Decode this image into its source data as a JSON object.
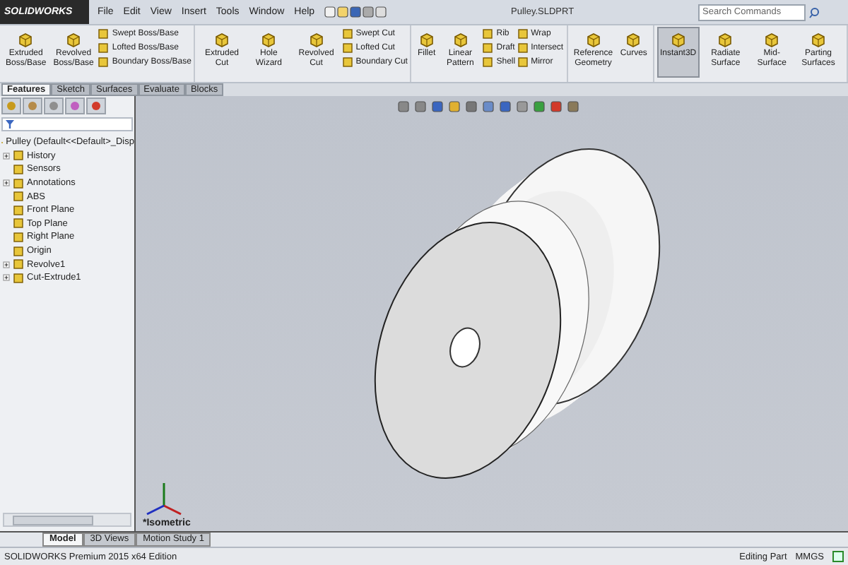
{
  "window": {
    "logo": "SOLIDWORKS",
    "menu": [
      "File",
      "Edit",
      "View",
      "Insert",
      "Tools",
      "Window",
      "Help"
    ],
    "title": "Pulley.SLDPRT",
    "search": {
      "placeholder": "Search Commands"
    }
  },
  "ribbon": [
    {
      "tools": [
        {
          "kind": "large",
          "label": "Extruded Boss/Base",
          "selected": false
        },
        {
          "kind": "large",
          "label": "Revolved Boss/Base",
          "selected": false
        },
        {
          "kind": "stack",
          "items": [
            "Swept Boss/Base",
            "Lofted Boss/Base",
            "Boundary Boss/Base"
          ]
        }
      ]
    },
    {
      "tools": [
        {
          "kind": "large",
          "label": "Extruded Cut",
          "selected": false
        },
        {
          "kind": "large",
          "label": "Hole Wizard",
          "selected": false
        },
        {
          "kind": "large",
          "label": "Revolved Cut",
          "selected": false
        },
        {
          "kind": "stack",
          "items": [
            "Swept Cut",
            "Lofted Cut",
            "Boundary Cut"
          ]
        }
      ]
    },
    {
      "tools": [
        {
          "kind": "large",
          "label": "Fillet",
          "selected": false
        },
        {
          "kind": "large",
          "label": "Linear Pattern",
          "selected": false
        },
        {
          "kind": "stack",
          "items": [
            "Rib",
            "Draft",
            "Shell"
          ]
        },
        {
          "kind": "stack",
          "items": [
            "Wrap",
            "Intersect",
            "Mirror"
          ]
        }
      ]
    },
    {
      "tools": [
        {
          "kind": "large",
          "label": "Reference Geometry",
          "selected": false
        },
        {
          "kind": "large",
          "label": "Curves",
          "selected": false
        }
      ]
    },
    {
      "tools": [
        {
          "kind": "large",
          "label": "Instant3D",
          "selected": true
        },
        {
          "kind": "large",
          "label": "Radiate Surface",
          "selected": false
        },
        {
          "kind": "large",
          "label": "Mid-Surface",
          "selected": false
        },
        {
          "kind": "large",
          "label": "Parting Surfaces",
          "selected": false
        }
      ]
    }
  ],
  "command_tabs": [
    {
      "label": "Features",
      "selected": true
    },
    {
      "label": "Sketch",
      "selected": false
    },
    {
      "label": "Surfaces",
      "selected": false
    },
    {
      "label": "Evaluate",
      "selected": false
    },
    {
      "label": "Blocks",
      "selected": false
    }
  ],
  "tree": {
    "root": "Pulley  (Default<<Default>_Disp",
    "items": [
      {
        "label": "History",
        "expanded": false
      },
      {
        "label": "Sensors"
      },
      {
        "label": "Annotations",
        "expanded": false
      },
      {
        "label": "ABS"
      },
      {
        "label": "Front Plane"
      },
      {
        "label": "Top Plane"
      },
      {
        "label": "Right Plane"
      },
      {
        "label": "Origin"
      },
      {
        "label": "Revolve1",
        "expanded": false
      },
      {
        "label": "Cut-Extrude1",
        "expanded": false
      }
    ]
  },
  "viewport": {
    "view_label": "*Isometric"
  },
  "bottom_tabs": [
    {
      "label": "Model",
      "selected": true
    },
    {
      "label": "3D Views",
      "selected": false
    },
    {
      "label": "Motion Study 1",
      "selected": false
    }
  ],
  "status_bar": {
    "edition": "SOLIDWORKS Premium 2015 x64 Edition",
    "mode": "Editing Part",
    "units": "MMGS"
  }
}
